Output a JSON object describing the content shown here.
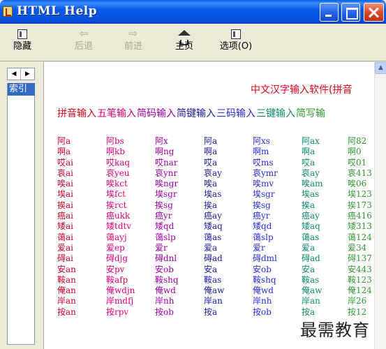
{
  "window": {
    "title": "HTML Help"
  },
  "toolbar": {
    "hide_label": "隐藏",
    "back_label": "后退",
    "forward_label": "前进",
    "home_label": "主页",
    "options_label": "选项(O)"
  },
  "nav": {
    "tab_label": "索引"
  },
  "content": {
    "heading": "中文汉字输入软件(拼音",
    "methods": [
      {
        "label": "拼音输入",
        "color": "#e0001a"
      },
      {
        "label": "五笔输入",
        "color": "#e0007a"
      },
      {
        "label": "简码输入",
        "color": "#9e00a8"
      },
      {
        "label": "简键输入",
        "color": "#1a1a9e"
      },
      {
        "label": "三码输入",
        "color": "#2a2ae0"
      },
      {
        "label": "三键输入",
        "color": "#0a8a6a"
      },
      {
        "label": "简写输",
        "color": "#2e9a2e"
      }
    ],
    "columns": [
      {
        "color": "#c8002a",
        "rows": [
          "阿a",
          "啊a",
          "哎ai",
          "哀ai",
          "唉ai",
          "埃ai",
          "挨ai",
          "癌ai",
          "矮ai",
          "蔼ai",
          "爱ai",
          "碍ai",
          "安an",
          "鞍an",
          "俺an",
          "岸an",
          "按an"
        ]
      },
      {
        "color": "#e0007a",
        "rows": [
          "阿bs",
          "啊kb",
          "哎kaq",
          "哀yeu",
          "唉kct",
          "埃fct",
          "挨rct",
          "癌ukk",
          "矮tdtv",
          "蔼ayj",
          "爱ep",
          "碍djg",
          "安pv",
          "鞍afp",
          "俺wdjn",
          "岸mdfj",
          "按rpv"
        ]
      },
      {
        "color": "#9e00a8",
        "rows": [
          "阿x",
          "啊ng",
          "哎nar",
          "哀ynr",
          "唉ngr",
          "埃sgr",
          "挨sg",
          "癌yr",
          "矮qd",
          "蔼slp",
          "爱r",
          "碍dnl",
          "安ob",
          "鞍shq",
          "俺wd",
          "岸nh",
          "按ob"
        ]
      },
      {
        "color": "#1a1a9e",
        "rows": [
          "阿a",
          "啊a",
          "哎a",
          "哀ay",
          "唉a",
          "埃as",
          "挨a",
          "癌ay",
          "矮aq",
          "蔼as",
          "爱a",
          "碍ad",
          "安a",
          "鞍as",
          "俺aw",
          "岸an",
          "按a"
        ]
      },
      {
        "color": "#2a2ae0",
        "rows": [
          "阿xs",
          "啊m",
          "哎ms",
          "哀ymr",
          "唉mv",
          "埃sgr",
          "挨sg",
          "癌yr",
          "矮qd",
          "蔼slp",
          "爱r",
          "碍dml",
          "安ob",
          "鞍shq",
          "俺wd",
          "岸nh",
          "按ob"
        ]
      },
      {
        "color": "#0a8a6a",
        "rows": [
          "阿ax",
          "啊a",
          "哎a",
          "哀ay",
          "唉am",
          "埃as",
          "挨a",
          "癌ay",
          "矮aq",
          "蔼as",
          "爱a",
          "碍ad",
          "安a",
          "鞍as",
          "俺aw",
          "岸an",
          "按a"
        ]
      },
      {
        "color": "#2e9a2e",
        "rows": [
          "阿82",
          "啊0",
          "哎01",
          "哀413",
          "唉06",
          "埃123",
          "挨173",
          "癌416",
          "矮313",
          "蔼124",
          "爱34",
          "碍137",
          "安443",
          "鞍123",
          "俺124",
          "岸26",
          "按12"
        ]
      }
    ]
  },
  "watermark": "最需教育"
}
